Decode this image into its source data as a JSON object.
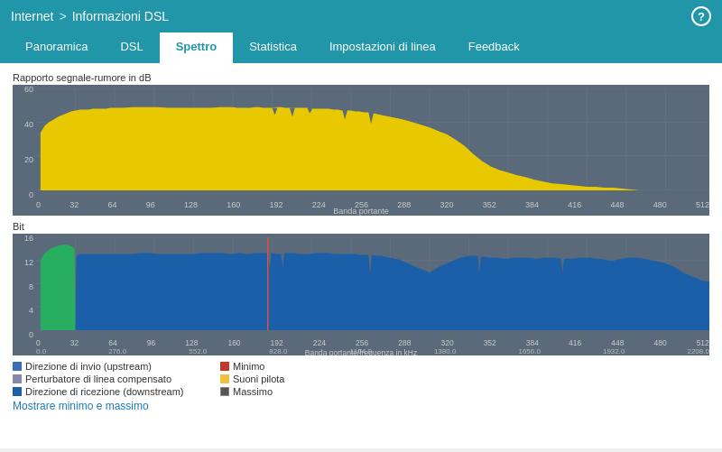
{
  "header": {
    "breadcrumb_part1": "Internet",
    "breadcrumb_sep": ">",
    "breadcrumb_part2": "Informazioni DSL",
    "help_label": "?"
  },
  "tabs": [
    {
      "id": "panoramica",
      "label": "Panoramica",
      "active": false
    },
    {
      "id": "dsl",
      "label": "DSL",
      "active": false
    },
    {
      "id": "spettro",
      "label": "Spettro",
      "active": true
    },
    {
      "id": "statistica",
      "label": "Statistica",
      "active": false
    },
    {
      "id": "impostazioni",
      "label": "Impostazioni di linea",
      "active": false
    },
    {
      "id": "feedback",
      "label": "Feedback",
      "active": false
    }
  ],
  "top_chart": {
    "y_label": "Rapporto segnale-rumore in dB",
    "y_ticks": [
      "60",
      "40",
      "20",
      "0"
    ],
    "x_ticks": [
      "0",
      "32",
      "64",
      "96",
      "128",
      "160",
      "192",
      "224",
      "256",
      "288",
      "320",
      "352",
      "384",
      "416",
      "448",
      "480",
      "512"
    ],
    "x_axis_label": "Banda portante"
  },
  "bottom_chart": {
    "y_label": "Bit",
    "y_ticks": [
      "16",
      "12",
      "8",
      "4",
      "0"
    ],
    "x_ticks_top": [
      "0",
      "32",
      "64",
      "96",
      "128",
      "160",
      "192",
      "224",
      "256",
      "288",
      "320",
      "352",
      "384",
      "416",
      "448",
      "480",
      "512"
    ],
    "x_ticks_bottom": [
      "0.0",
      "276.0",
      "552.0",
      "828.0",
      "1104.0",
      "1380.0",
      "1656.0",
      "1932.0",
      "2208.0"
    ],
    "x_axis_label": "Banda portante/frequenza in kHz"
  },
  "legend": {
    "items": [
      {
        "color": "#3a6eb5",
        "label": "Direzione di invio (upstream)"
      },
      {
        "color": "#c0392b",
        "label": "Minimo"
      },
      {
        "color": "#8888aa",
        "label": "Perturbatore di linea compensato"
      },
      {
        "color": "#f0c040",
        "label": "Suoni pilota"
      },
      {
        "color": "#2471b8",
        "label": "Direzione di ricezione (downstream)"
      },
      {
        "color": "#555",
        "label": "Massimo"
      }
    ],
    "show_link": "Mostrare minimo e massimo"
  }
}
